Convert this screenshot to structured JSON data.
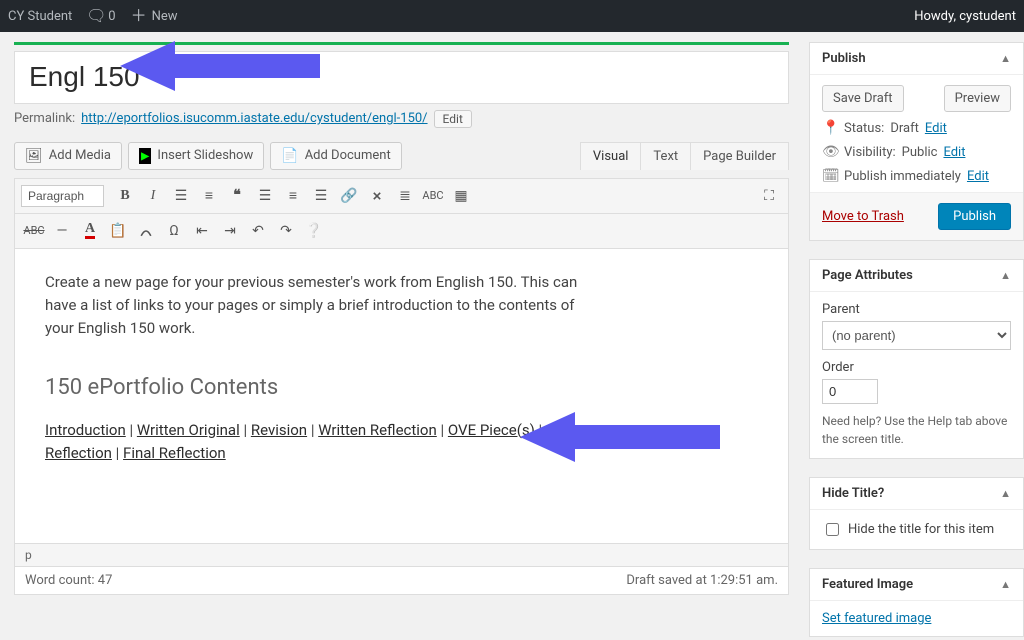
{
  "adminbar": {
    "site_label": "CY Student",
    "comments_count": "0",
    "new_label": "New",
    "howdy": "Howdy, cystudent"
  },
  "title": "Engl 150",
  "permalink": {
    "label": "Permalink:",
    "url": "http://eportfolios.isucomm.iastate.edu/cystudent/engl-150/",
    "edit": "Edit"
  },
  "media_buttons": {
    "add_media": "Add Media",
    "insert_slideshow": "Insert Slideshow",
    "add_document": "Add Document"
  },
  "editor_tabs": {
    "visual": "Visual",
    "text": "Text",
    "page_builder": "Page Builder"
  },
  "toolbar": {
    "format_dropdown": "Paragraph"
  },
  "editor": {
    "intro": "Create a new page for your previous semester's work from English 150. This can have a list of links to your pages or simply a brief introduction to the contents of your English 150 work.",
    "heading": "150 ePortfolio Contents",
    "links": [
      "Introduction",
      "Written Original",
      "Revision",
      "Written Reflection",
      "OVE Piece(s)",
      "OVE Reflection",
      "Final Reflection"
    ]
  },
  "status_path": "p",
  "footer": {
    "word_count_label": "Word count:",
    "word_count": "47",
    "draft_saved": "Draft saved at 1:29:51 am."
  },
  "publish": {
    "title": "Publish",
    "save_draft": "Save Draft",
    "preview": "Preview",
    "status_label": "Status:",
    "status_value": "Draft",
    "visibility_label": "Visibility:",
    "visibility_value": "Public",
    "schedule_label": "Publish immediately",
    "edit": "Edit",
    "trash": "Move to Trash",
    "submit": "Publish"
  },
  "page_attributes": {
    "title": "Page Attributes",
    "parent_label": "Parent",
    "parent_value": "(no parent)",
    "order_label": "Order",
    "order_value": "0",
    "help": "Need help? Use the Help tab above the screen title."
  },
  "hide_title": {
    "title": "Hide Title?",
    "checkbox_label": "Hide the title for this item"
  },
  "featured": {
    "title": "Featured Image",
    "link": "Set featured image"
  }
}
